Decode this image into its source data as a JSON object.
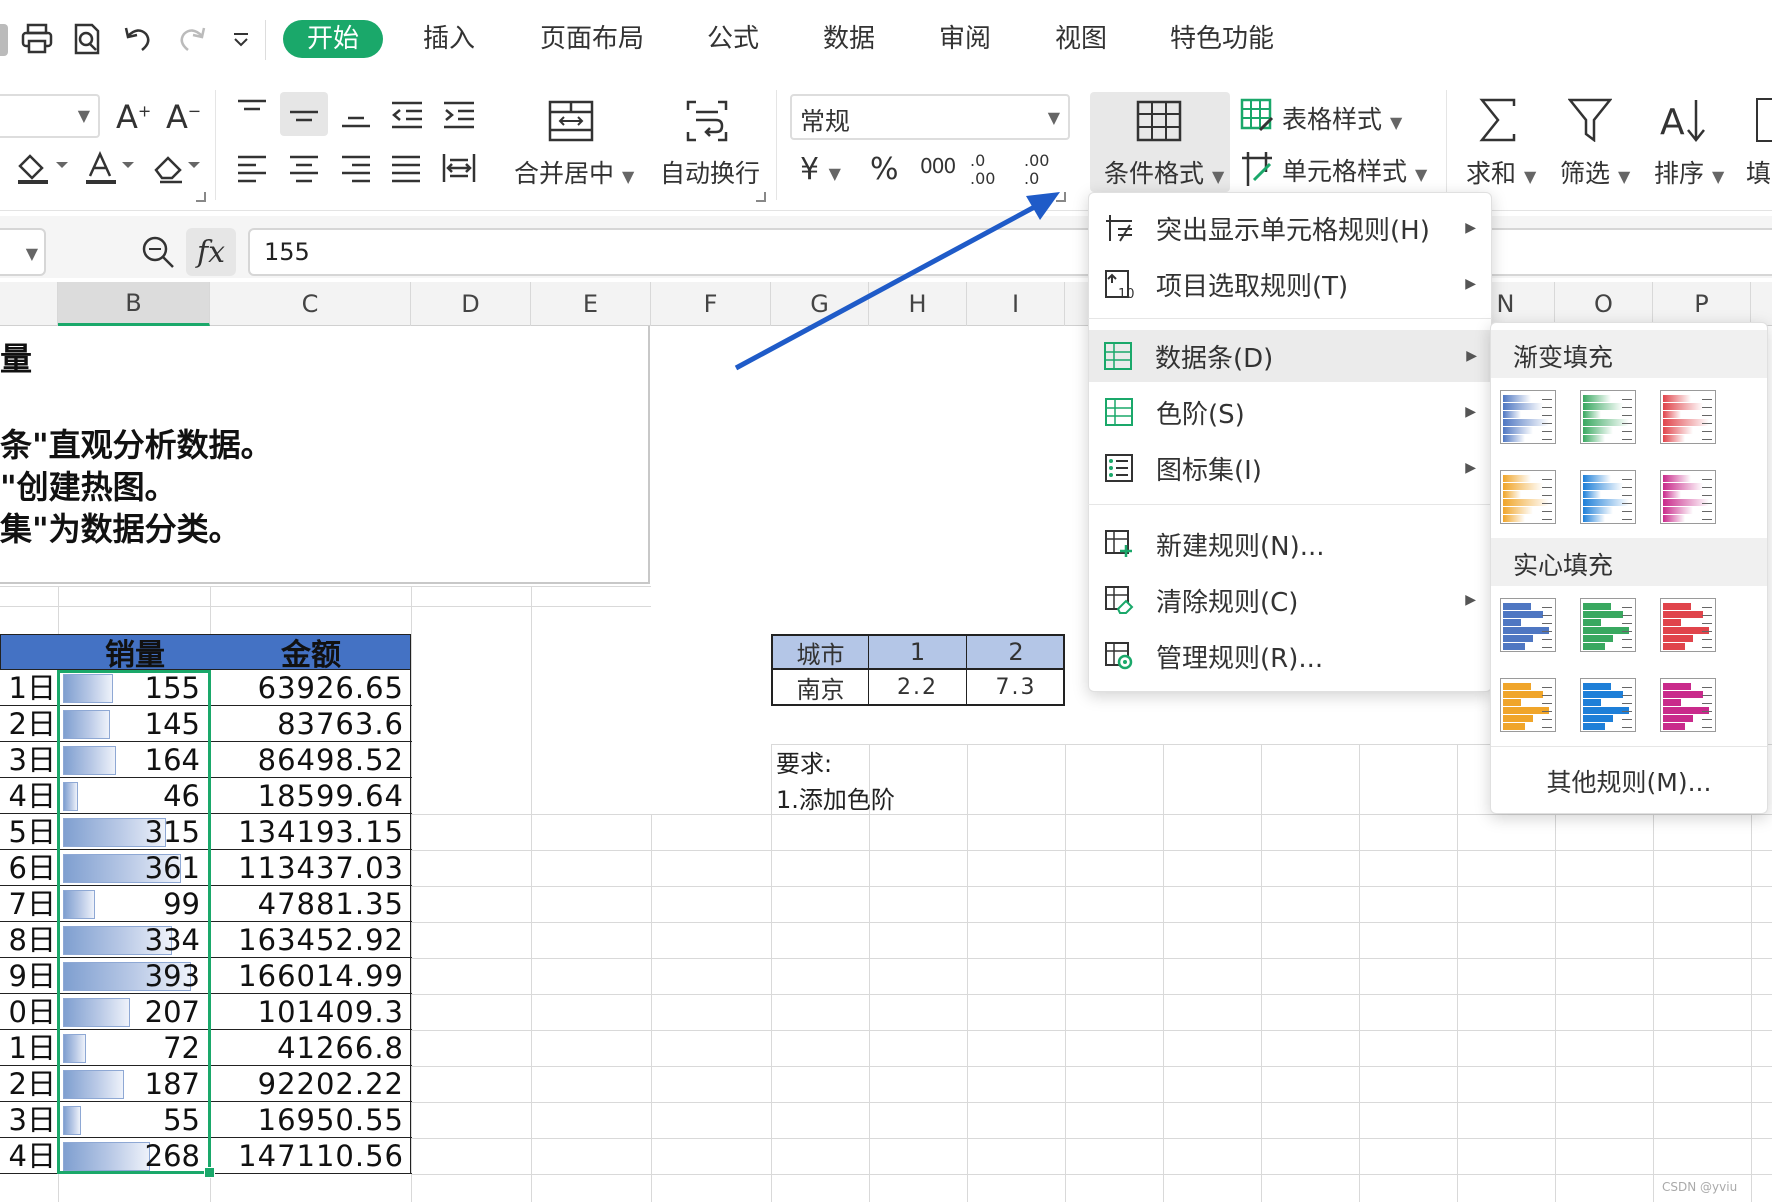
{
  "ribbon": {
    "tabs": [
      {
        "label": "开始",
        "active": true
      },
      {
        "label": "插入"
      },
      {
        "label": "页面布局"
      },
      {
        "label": "公式"
      },
      {
        "label": "数据"
      },
      {
        "label": "审阅"
      },
      {
        "label": "视图"
      },
      {
        "label": "特色功能"
      }
    ],
    "merge_center_label": "合并居中",
    "wrap_text_label": "自动换行",
    "number_format_value": "常规",
    "conditional_format_label": "条件格式",
    "table_style_label": "表格样式",
    "cell_style_label": "单元格样式",
    "sum_label": "求和",
    "filter_label": "筛选",
    "sort_label": "排序",
    "fill_label": "填",
    "currency_symbol": "¥",
    "percent_symbol": "%",
    "thousands_symbol": "000",
    "increase_decimal": ".0 .00",
    "decrease_decimal": ".00 .0"
  },
  "formula_bar": {
    "fx_label": "fx",
    "value": "155"
  },
  "columns": [
    "B",
    "C",
    "D",
    "E",
    "F",
    "G",
    "H",
    "I",
    "N",
    "O",
    "P"
  ],
  "instruction_box": {
    "title_fragment": "量",
    "lines": [
      "条\"直观分析数据。",
      "\"创建热图。",
      "集\"为数据分类。"
    ]
  },
  "sales_table": {
    "headers": [
      "销量",
      "金额"
    ],
    "rows": [
      {
        "day": "1日",
        "qty": "155",
        "amount": "63926.65",
        "fraction": 0.394
      },
      {
        "day": "2日",
        "qty": "145",
        "amount": "83763.6",
        "fraction": 0.369
      },
      {
        "day": "3日",
        "qty": "164",
        "amount": "86498.52",
        "fraction": 0.417
      },
      {
        "day": "4日",
        "qty": "46",
        "amount": "18599.64",
        "fraction": 0.117
      },
      {
        "day": "5日",
        "qty": "315",
        "amount": "134193.15",
        "fraction": 0.802
      },
      {
        "day": "6日",
        "qty": "361",
        "amount": "113437.03",
        "fraction": 0.919
      },
      {
        "day": "7日",
        "qty": "99",
        "amount": "47881.35",
        "fraction": 0.252
      },
      {
        "day": "8日",
        "qty": "334",
        "amount": "163452.92",
        "fraction": 0.85
      },
      {
        "day": "9日",
        "qty": "393",
        "amount": "166014.99",
        "fraction": 1.0
      },
      {
        "day": "0日",
        "qty": "207",
        "amount": "101409.3",
        "fraction": 0.527
      },
      {
        "day": "1日",
        "qty": "72",
        "amount": "41266.8",
        "fraction": 0.183
      },
      {
        "day": "2日",
        "qty": "187",
        "amount": "92202.22",
        "fraction": 0.476
      },
      {
        "day": "3日",
        "qty": "55",
        "amount": "16950.55",
        "fraction": 0.14
      },
      {
        "day": "4日",
        "qty": "268",
        "amount": "147110.56",
        "fraction": 0.682
      }
    ]
  },
  "city_table": {
    "headers": [
      "城市",
      "1",
      "2"
    ],
    "row": [
      "南京",
      "2.2",
      "7.3"
    ]
  },
  "requirement": {
    "title": "要求:",
    "item1": "1.添加色阶"
  },
  "cond_menu": {
    "items": [
      {
        "label": "突出显示单元格规则(H)",
        "icon": "highlight-rules-icon",
        "arrow": true
      },
      {
        "label": "项目选取规则(T)",
        "icon": "top-bottom-rules-icon",
        "arrow": true
      },
      {
        "label": "数据条(D)",
        "icon": "data-bars-icon",
        "arrow": true,
        "highlighted": true
      },
      {
        "label": "色阶(S)",
        "icon": "color-scales-icon",
        "arrow": true
      },
      {
        "label": "图标集(I)",
        "icon": "icon-sets-icon",
        "arrow": true
      },
      {
        "label": "新建规则(N)...",
        "icon": "new-rule-icon",
        "arrow": false
      },
      {
        "label": "清除规则(C)",
        "icon": "clear-rules-icon",
        "arrow": true
      },
      {
        "label": "管理规则(R)...",
        "icon": "manage-rules-icon",
        "arrow": false
      }
    ]
  },
  "databar_submenu": {
    "gradient_title": "渐变填充",
    "solid_title": "实心填充",
    "other_rules": "其他规则(M)...",
    "colors": [
      "#4f77c2",
      "#39a860",
      "#e0444b",
      "#f0a52a",
      "#1e7fd8",
      "#c92a8b"
    ]
  },
  "watermark": "CSDN @yviu"
}
